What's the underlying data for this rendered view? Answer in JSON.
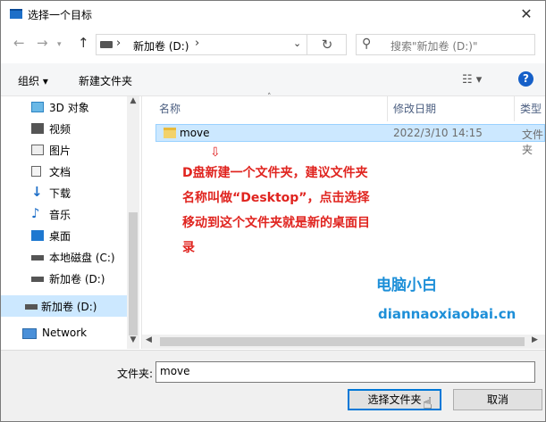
{
  "window": {
    "title": "选择一个目标",
    "close_label": "✕"
  },
  "nav": {
    "back": "←",
    "forward": "→",
    "up": "↑",
    "address_drive_label": "新加卷 (D:)",
    "address_chevron": "›",
    "search_placeholder": "搜索\"新加卷 (D:)\""
  },
  "toolbar": {
    "organize": "组织 ▾",
    "new_folder": "新建文件夹",
    "help": "?"
  },
  "sidebar": {
    "items": [
      {
        "label": "3D 对象",
        "icon": "3d-objects-icon"
      },
      {
        "label": "视频",
        "icon": "video-icon"
      },
      {
        "label": "图片",
        "icon": "pictures-icon"
      },
      {
        "label": "文档",
        "icon": "documents-icon"
      },
      {
        "label": "下载",
        "icon": "download-icon"
      },
      {
        "label": "音乐",
        "icon": "music-icon"
      },
      {
        "label": "桌面",
        "icon": "desktop-icon"
      },
      {
        "label": "本地磁盘 (C:)",
        "icon": "drive-icon"
      },
      {
        "label": "新加卷 (D:)",
        "icon": "drive-icon"
      },
      {
        "label": "新加卷 (D:)",
        "icon": "drive-icon",
        "selected": true
      },
      {
        "label": "Network",
        "icon": "network-icon"
      }
    ]
  },
  "columns": {
    "name": "名称",
    "modified": "修改日期",
    "type": "类型"
  },
  "files": [
    {
      "name": "move",
      "modified": "2022/3/10 14:15",
      "type": "文件夹"
    }
  ],
  "annotation": {
    "arrow": "⇩",
    "text": "D盘新建一个文件夹，建议文件夹名称叫做“Desktop”，点击选择移动到这个文件夹就是新的桌面目录",
    "brand_cn": "电脑小白",
    "brand_url": "diannaoxiaobai.cn"
  },
  "footer": {
    "folder_label": "文件夹:",
    "folder_value": "move",
    "select_button": "选择文件夹",
    "cancel_button": "取消"
  }
}
